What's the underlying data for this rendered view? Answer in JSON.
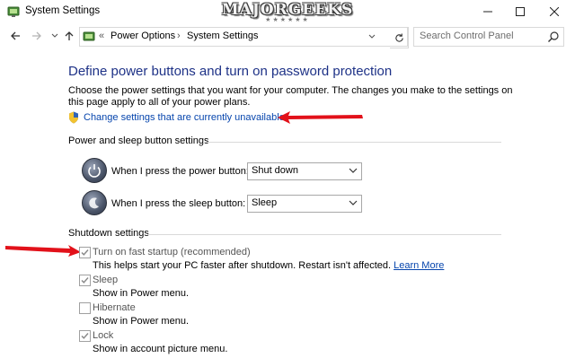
{
  "window": {
    "title": "System Settings",
    "controls": [
      "minimize",
      "maximize",
      "close"
    ]
  },
  "watermark": {
    "text": "MAJORGEEKS",
    "stars": "★★★★★★"
  },
  "nav": {
    "back_icon": "back-arrow-icon",
    "forward_icon": "forward-arrow-icon",
    "up_icon": "up-arrow-icon",
    "address_chevron": "«",
    "breadcrumbs": [
      "Power Options",
      "System Settings"
    ],
    "separator": "›",
    "search_placeholder": "Search Control Panel"
  },
  "content": {
    "heading": "Define power buttons and turn on password protection",
    "intro": "Choose the power settings that you want for your computer. The changes you make to the settings on this page apply to all of your power plans.",
    "change_link": "Change settings that are currently unavailable",
    "power_section_title": "Power and sleep button settings",
    "power_button_label": "When I press the power button:",
    "power_button_value": "Shut down",
    "sleep_button_label": "When I press the sleep button:",
    "sleep_button_value": "Sleep",
    "shutdown_section_title": "Shutdown settings",
    "shutdown_options": [
      {
        "label": "Turn on fast startup (recommended)",
        "checked": true,
        "description": "This helps start your PC faster after shutdown. Restart isn't affected.",
        "link": "Learn More"
      },
      {
        "label": "Sleep",
        "checked": true,
        "description": "Show in Power menu."
      },
      {
        "label": "Hibernate",
        "checked": false,
        "description": "Show in Power menu."
      },
      {
        "label": "Lock",
        "checked": true,
        "description": "Show in account picture menu."
      }
    ]
  },
  "colors": {
    "heading": "#1e3287",
    "link": "#0645ad",
    "annotation_arrow": "#e2111a"
  }
}
